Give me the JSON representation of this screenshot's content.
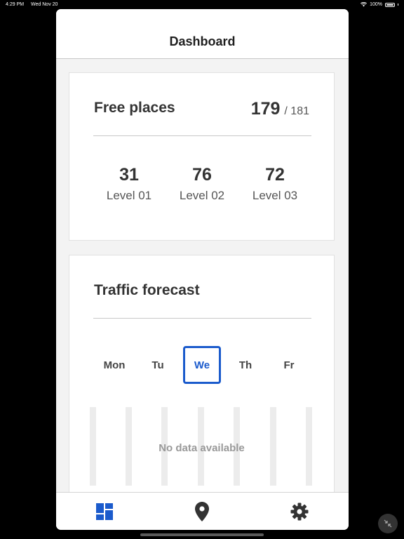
{
  "status_bar": {
    "time": "4:29 PM",
    "date": "Wed Nov 20",
    "battery": "100%"
  },
  "nav": {
    "title": "Dashboard"
  },
  "free_places": {
    "title": "Free places",
    "available": "179",
    "total": "/ 181",
    "levels": [
      {
        "count": "31",
        "label": "Level 01"
      },
      {
        "count": "76",
        "label": "Level 02"
      },
      {
        "count": "72",
        "label": "Level 03"
      }
    ]
  },
  "traffic_forecast": {
    "title": "Traffic forecast",
    "days": [
      "Mon",
      "Tu",
      "We",
      "Th",
      "Fr"
    ],
    "selected_day": "We",
    "empty_message": "No data available"
  },
  "tab_bar": {
    "tabs": [
      "dashboard-icon",
      "location-pin-icon",
      "gear-icon"
    ],
    "active": "dashboard-icon"
  },
  "colors": {
    "accent": "#1b5bcc",
    "text": "#333333",
    "muted": "#999999",
    "background": "#f3f3f3"
  }
}
